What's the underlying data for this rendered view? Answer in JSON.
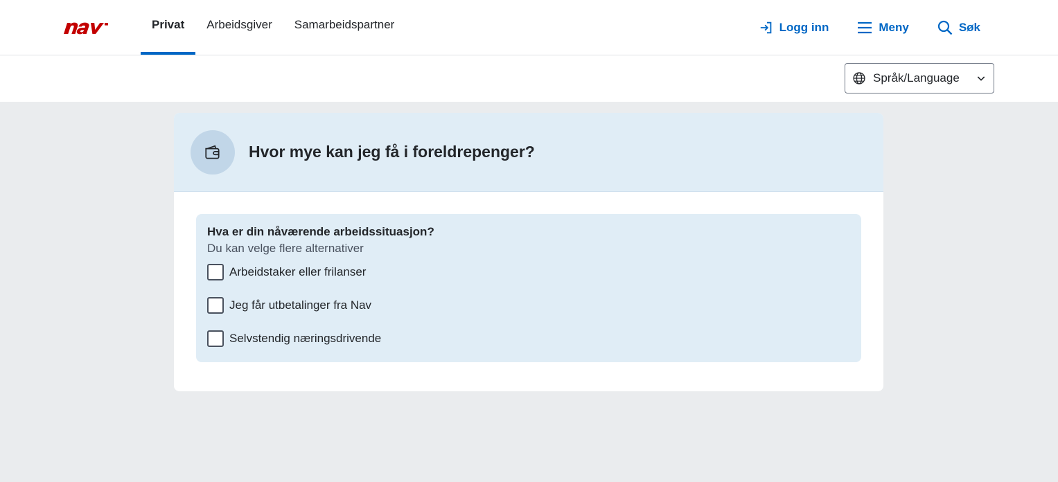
{
  "header": {
    "logo_text": "nav",
    "tabs": [
      {
        "label": "Privat",
        "active": true
      },
      {
        "label": "Arbeidsgiver",
        "active": false
      },
      {
        "label": "Samarbeidspartner",
        "active": false
      }
    ],
    "login_label": "Logg inn",
    "menu_label": "Meny",
    "search_label": "Søk",
    "brand_color": "#c30000",
    "accent_color": "#0067c5"
  },
  "language": {
    "label": "Språk/Language"
  },
  "card": {
    "icon": "wallet-icon",
    "title": "Hvor mye kan jeg få i foreldrepenger?"
  },
  "question": {
    "legend": "Hva er din nåværende arbeidssituasjon?",
    "description": "Du kan velge flere alternativer",
    "options": [
      {
        "label": "Arbeidstaker eller frilanser",
        "checked": false
      },
      {
        "label": "Jeg får utbetalinger fra Nav",
        "checked": false
      },
      {
        "label": "Selvstendig næringsdrivende",
        "checked": false
      }
    ]
  }
}
